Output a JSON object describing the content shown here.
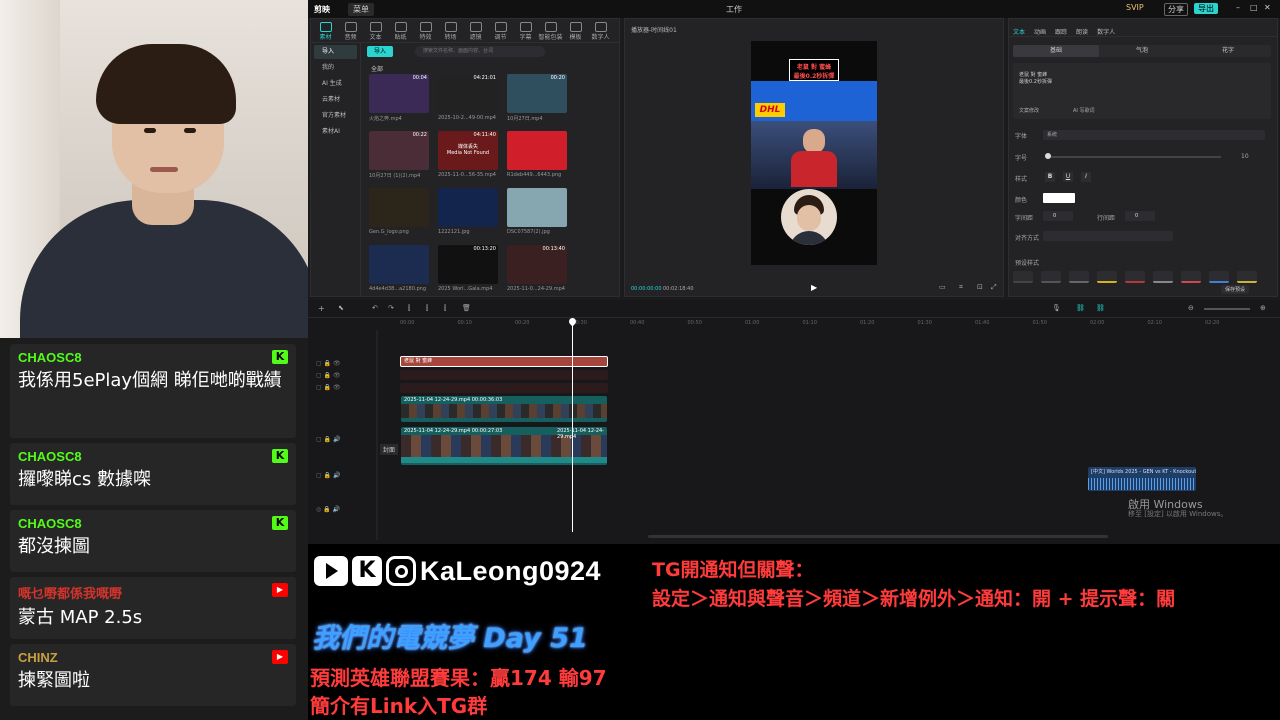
{
  "chat": {
    "messages": [
      {
        "user": "CHAOSC8",
        "text": "我係用5ePlay個網 睇佢哋啲戰績￼",
        "platform": "kick",
        "user_color": "#53fc18"
      },
      {
        "user": "CHAOSC8",
        "text": "攞嚟睇cs 數據㗎￼",
        "platform": "kick",
        "user_color": "#53fc18"
      },
      {
        "user": "CHAOSC8",
        "text": "都沒揀圖￼",
        "platform": "kick",
        "user_color": "#53fc18"
      },
      {
        "user": "嘅乜嘢都係我嘅嘢",
        "text": "蒙古 MAP 2.5s",
        "platform": "youtube",
        "user_color": "#d0342c"
      },
      {
        "user": "CHINZ",
        "text": "揀緊圖啦",
        "platform": "youtube",
        "user_color": "#c8a040"
      }
    ]
  },
  "editor": {
    "app_name": "剪映",
    "menu_label": "菜单",
    "window_title": "工作",
    "topbar_right": [
      "SVIP",
      "分享",
      "导出"
    ],
    "toolbar": [
      "素材",
      "音频",
      "文本",
      "贴纸",
      "特效",
      "转场",
      "滤镜",
      "调节",
      "字幕",
      "智能包装",
      "模板",
      "数字人"
    ],
    "sidebar": [
      "导入",
      "我的",
      "AI 生成",
      "云素材",
      "官方素材",
      "素材AI"
    ],
    "import_button": "导入",
    "search_placeholder": "搜索文件名称、画面内容、台词",
    "filter_all": "全部",
    "media": [
      {
        "label": "火焰之奔.mp4",
        "duration": "00:04",
        "color": "#3a2a55"
      },
      {
        "label": "2025-10-2...49-00.mp4",
        "duration": "04:21:01",
        "color": "#222"
      },
      {
        "label": "10月27日.mp4",
        "duration": "00:20",
        "color": "#2f4f5f"
      },
      {
        "label": "10月27日 (1)(2).mp4",
        "duration": "00:22",
        "color": "#4a2d36"
      },
      {
        "label": "2025-11-0...56-35.mp4",
        "duration": "04:11:40",
        "color": "#6a1a1a",
        "overlay": "媒体丢失\nMedia Not Found"
      },
      {
        "label": "R1deb449...6443.png",
        "duration": "",
        "color": "#d01f2b"
      },
      {
        "label": "Gen.G_logo.png",
        "duration": "",
        "color": "#2b2619"
      },
      {
        "label": "1222121.jpg",
        "duration": "",
        "color": "#14254d"
      },
      {
        "label": "DSC07587(2).jpg",
        "duration": "",
        "color": "#86a6b0"
      },
      {
        "label": "4d4e4d38...a2180.png",
        "duration": "",
        "color": "#1c2b50"
      },
      {
        "label": "2025 Worl...Gala.mp4",
        "duration": "00:13:20",
        "color": "#111"
      },
      {
        "label": "2025-11-0...24-29.mp4",
        "duration": "00:13:40",
        "color": "#3a2020"
      }
    ],
    "player": {
      "title": "播放器-时间线01",
      "caption_top": "老鼠 對 蜜蜂",
      "caption_bottom": "最後0.2秒拆彈",
      "time_current": "00:00:00:00",
      "time_total": "00:02:18:40",
      "brand": "DHL"
    },
    "inspector": {
      "tabs": [
        "文本",
        "动画",
        "跟踪",
        "朗读",
        "数字人"
      ],
      "subtabs": [
        "基础",
        "气泡",
        "花字"
      ],
      "text_preview_1": "老鼠 對 蜜蜂",
      "text_preview_2": "最後0.2秒拆彈",
      "ai_hint": "文案修改",
      "ai_write": "AI 写歌词",
      "font_label": "字体",
      "font_value": "系统",
      "size_label": "字号",
      "size_value": "10",
      "style_label": "样式",
      "color_label": "颜色",
      "spacing_label": "字间距",
      "spacing_value": "0",
      "line_label": "行间距",
      "line_value": "0",
      "align_label": "对齐方式",
      "preset_label": "预设样式",
      "save_preset": "保存预设"
    },
    "timeline": {
      "ruler": [
        "00:00",
        "00:10",
        "00:20",
        "00:30",
        "00:40",
        "00:50",
        "01:00",
        "01:10",
        "01:20",
        "01:30",
        "01:40",
        "01:50",
        "02:00",
        "02:10",
        "02:20"
      ],
      "text_clip": "老鼠 對 蜜蜂",
      "video_clip_1": "2025-11-04 12-24-29.mp4  00:00:36:03",
      "video_clip_2": "2025-11-04 12-24-29.mp4  00:00:27:03",
      "video_clip_2b": "2025-11-04 12-24-29.mp4",
      "cover_label": "封面",
      "audio_clip": "[中文] Worlds 2025 - GEN vs KT - Knockout !",
      "windows_activate": "啟用 Windows",
      "windows_activate_sub": "移至 [設定] 以啟用 Windows。"
    }
  },
  "overlay": {
    "handle": "KaLeong0924",
    "tg_line1": "TG開通知但關聲：",
    "tg_line2": "設定＞通知與聲音＞頻道＞新增例外＞通知：開 + 提示聲：關",
    "stream_title": "我們的電競夢 Day 51",
    "prediction": "預測英雄聯盟賽果：贏174 輸97",
    "tg_link": "簡介有Link入TG群"
  },
  "colors": {
    "accent": "#29d4d1",
    "kick": "#53fc18",
    "youtube": "#ff0000",
    "tg_red": "#ff3b3b"
  }
}
